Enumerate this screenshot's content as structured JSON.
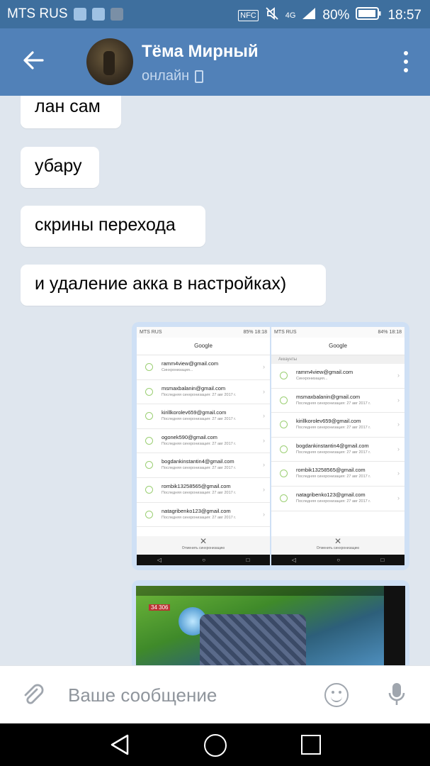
{
  "status_bar": {
    "carrier": "MTS RUS",
    "nfc": "NFC",
    "network": "4G",
    "battery": "80%",
    "time": "18:57"
  },
  "header": {
    "contact_name": "Тёма Мирный",
    "status": "онлайн"
  },
  "messages": [
    {
      "text": "лан сам"
    },
    {
      "text": "убару"
    },
    {
      "text": "скрины перехода"
    },
    {
      "text": "и удаление акка в настройках)"
    }
  ],
  "screenshot_left": {
    "status_carrier": "MTS RUS",
    "status_right": "85% 18:18",
    "title": "Google",
    "accounts": [
      {
        "email": "ramm4view@gmail.com",
        "sync": "Синхронизация..."
      },
      {
        "email": "msmaxbalanin@gmail.com",
        "sync": "Последняя синхронизация: 27 авг 2017 г."
      },
      {
        "email": "kirillkorolev659@gmail.com",
        "sync": "Последняя синхронизация: 27 авг 2017 г."
      },
      {
        "email": "ogonek590@gmail.com",
        "sync": "Последняя синхронизация: 27 авг 2017 г."
      },
      {
        "email": "bogdankinstantin4@gmail.com",
        "sync": "Последняя синхронизация: 27 авг 2017 г."
      },
      {
        "email": "rombik13258565@gmail.com",
        "sync": "Последняя синхронизация: 27 авг 2017 г."
      },
      {
        "email": "natagribenko123@gmail.com",
        "sync": "Последняя синхронизация: 27 авг 2017 г."
      }
    ],
    "cancel_label": "Отменить синхронизацию"
  },
  "screenshot_right": {
    "status_carrier": "MTS RUS",
    "status_right": "84% 18:18",
    "title": "Google",
    "section": "Аккаунты",
    "accounts": [
      {
        "email": "ramm4view@gmail.com",
        "sync": "Синхронизация..."
      },
      {
        "email": "msmaxbalanin@gmail.com",
        "sync": "Последняя синхронизация: 27 авг 2017 г."
      },
      {
        "email": "kirillkorolev659@gmail.com",
        "sync": "Последняя синхронизация: 27 авг 2017 г."
      },
      {
        "email": "bogdankinstantin4@gmail.com",
        "sync": "Последняя синхронизация: 27 авг 2017 г."
      },
      {
        "email": "rombik13258565@gmail.com",
        "sync": "Последняя синхронизация: 27 авг 2017 г."
      },
      {
        "email": "natagribenko123@gmail.com",
        "sync": "Последняя синхронизация: 27 авг 2017 г."
      }
    ],
    "cancel_label": "Отменить синхронизацию"
  },
  "game_screenshot": {
    "hud_value": "34 306"
  },
  "composer": {
    "placeholder": "Ваше сообщение"
  },
  "icons": {
    "back": "arrow-left-icon",
    "menu": "more-vertical-icon",
    "attach": "paperclip-icon",
    "emoji": "smile-icon",
    "mic": "microphone-icon"
  },
  "colors": {
    "header": "#5181b8",
    "status_bar": "#3e6f9e",
    "chat_background": "#dfe6ee",
    "attachment_bubble": "#cfe0f5"
  }
}
